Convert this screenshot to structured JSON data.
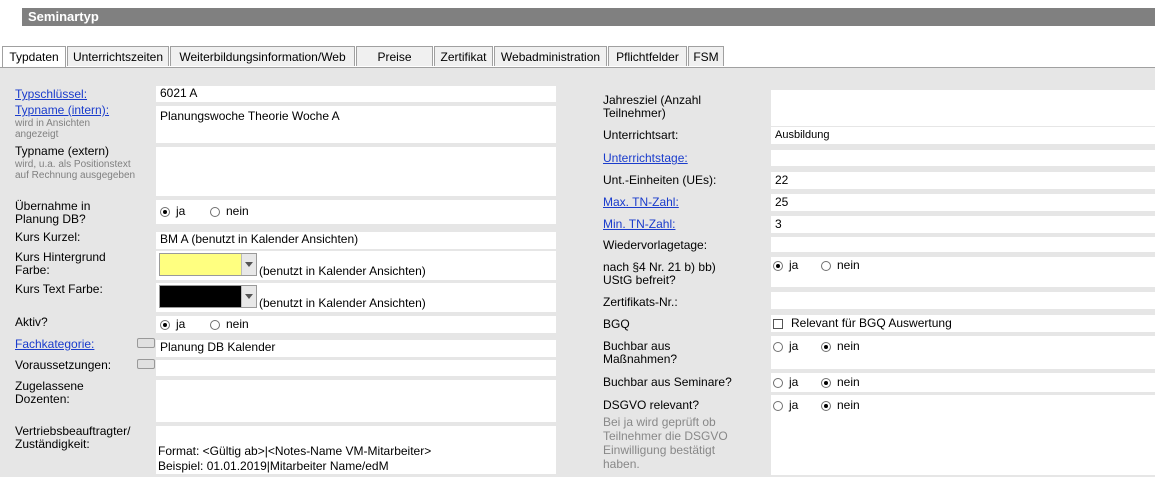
{
  "title": "Seminartyp",
  "tabs": [
    "Typdaten",
    "Unterrichtszeiten",
    "Weiterbildungsinformation/Web",
    "Preise",
    "Zertifikat",
    "Webadministration",
    "Pflichtfelder",
    "FSM"
  ],
  "left": {
    "typschluessel": {
      "label": "Typschlüssel:",
      "value": "6021 A"
    },
    "typname_intern": {
      "label": "Typname (intern):",
      "hint": "wird in Ansichten angezeigt",
      "value": "Planungswoche Theorie Woche A"
    },
    "typname_extern": {
      "label": "Typname (extern)",
      "hint": "wird, u.a. als Positionstext auf Rechnung ausgegeben",
      "value": ""
    },
    "uebernahme": {
      "label": "Übernahme in Planung DB?",
      "opt_ja": "ja",
      "opt_nein": "nein",
      "selected": "ja"
    },
    "kurs_kurzel": {
      "label": "Kurs Kurzel:",
      "value": "BM A (benutzt in Kalender Ansichten)"
    },
    "hintergrund": {
      "label": "Kurs Hintergrund Farbe:",
      "note": "(benutzt in Kalender Ansichten)",
      "color": "#ffff80"
    },
    "textfarbe": {
      "label": "Kurs Text Farbe:",
      "note": "(benutzt in Kalender Ansichten)",
      "color": "#000000"
    },
    "aktiv": {
      "label": "Aktiv?",
      "opt_ja": "ja",
      "opt_nein": "nein",
      "selected": "ja"
    },
    "fachkategorie": {
      "label": "Fachkategorie:",
      "value": "Planung DB Kalender"
    },
    "voraussetzungen": {
      "label": "Voraussetzungen:",
      "value": ""
    },
    "dozenten": {
      "label": "Zugelassene Dozenten:",
      "value": ""
    },
    "vertrieb": {
      "label": "Vertriebsbeauftragter/ Zuständigkeit:",
      "format": "Format: <Gültig ab>|<Notes-Name VM-Mitarbeiter>",
      "beispiel": "Beispiel: 01.01.2019|Mitarbeiter Name/edM"
    }
  },
  "right": {
    "jahresziel": {
      "label": "Jahresziel (Anzahl Teilnehmer)",
      "value": ""
    },
    "unterrichtsart": {
      "label": "Unterrichtsart:",
      "value": "Ausbildung"
    },
    "unterrichtstage": {
      "label": "Unterrichtstage:",
      "value": ""
    },
    "ues": {
      "label": "Unt.-Einheiten (UEs):",
      "value": "22"
    },
    "max_tn": {
      "label": "Max. TN-Zahl:",
      "value": "25"
    },
    "min_tn": {
      "label": "Min. TN-Zahl:",
      "value": "3"
    },
    "wiedervorlage": {
      "label": "Wiedervorlagetage:",
      "value": ""
    },
    "ustg": {
      "label": "nach §4 Nr. 21 b) bb) UStG befreit?",
      "opt_ja": "ja",
      "opt_nein": "nein",
      "selected": "ja"
    },
    "zertifikat": {
      "label": "Zertifikats-Nr.:",
      "value": ""
    },
    "bgq": {
      "label": "BGQ",
      "checkbox": "Relevant für BGQ Auswertung",
      "checked": false
    },
    "buchbar_massnahmen": {
      "label": "Buchbar aus Maßnahmen?",
      "opt_ja": "ja",
      "opt_nein": "nein",
      "selected": "nein"
    },
    "buchbar_seminare": {
      "label": "Buchbar aus Seminare?",
      "opt_ja": "ja",
      "opt_nein": "nein",
      "selected": "nein"
    },
    "dsgvo": {
      "label": "DSGVO relevant?",
      "hint": "Bei ja wird geprüft ob Teilnehmer die DSGVO Einwilligung bestätigt haben.",
      "opt_ja": "ja",
      "opt_nein": "nein",
      "selected": "nein"
    }
  }
}
